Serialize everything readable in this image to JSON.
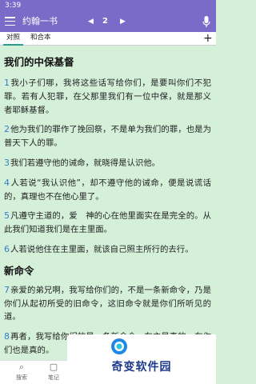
{
  "status": {
    "time": "3:39"
  },
  "appbar": {
    "book": "约翰一书",
    "prev_icon": "◀",
    "page": "2",
    "next_icon": "▶"
  },
  "tabs": [
    {
      "label": "对照",
      "active": true
    },
    {
      "label": "和合本",
      "active": false
    }
  ],
  "tab_add": "+",
  "chapter": {
    "sections": [
      {
        "heading": "我们的中保基督",
        "verses": [
          {
            "num": "1",
            "text": "我小子们哪，我将这些话写给你们，是要叫你们不犯罪。若有人犯罪，在父那里我们有一位中保，就是那义者耶稣基督。"
          },
          {
            "num": "2",
            "text": "他为我们的罪作了挽回祭，不是单为我们的罪，也是为普天下人的罪。"
          },
          {
            "num": "3",
            "text": "我们若遵守他的诫命，就晓得是认识他。"
          },
          {
            "num": "4",
            "text": "人若说“我认识他”，却不遵守他的诫命，便是说谎话的，真理也不在他心里了。"
          },
          {
            "num": "5",
            "text": "凡遵守主道的，爱　神的心在他里面实在是完全的。从此我们知道我们是在主里面。"
          },
          {
            "num": "6",
            "text": "人若说他住在主里面，就该自己照主所行的去行。"
          }
        ]
      },
      {
        "heading": "新命令",
        "verses": [
          {
            "num": "7",
            "text": "亲爱的弟兄啊，我写给你们的，不是一条新命令，乃是你们从起初所受的旧命令，这旧命令就是你们所听见的道。"
          },
          {
            "num": "8",
            "text": "再者，我写给你们的是一条新命令，在主是真的，在你们也是真的。"
          }
        ]
      }
    ]
  },
  "bottom_nav": [
    {
      "icon": "⌕",
      "label": "搜索"
    },
    {
      "icon": "▢",
      "label": "笔记"
    }
  ],
  "watermark": {
    "text": "奇变软件园"
  },
  "colors": {
    "appbar": "#7b6bc9",
    "background": "#d4f0d9",
    "verse_number": "#3a7bc8",
    "tab_indicator": "#2a9d8f"
  }
}
